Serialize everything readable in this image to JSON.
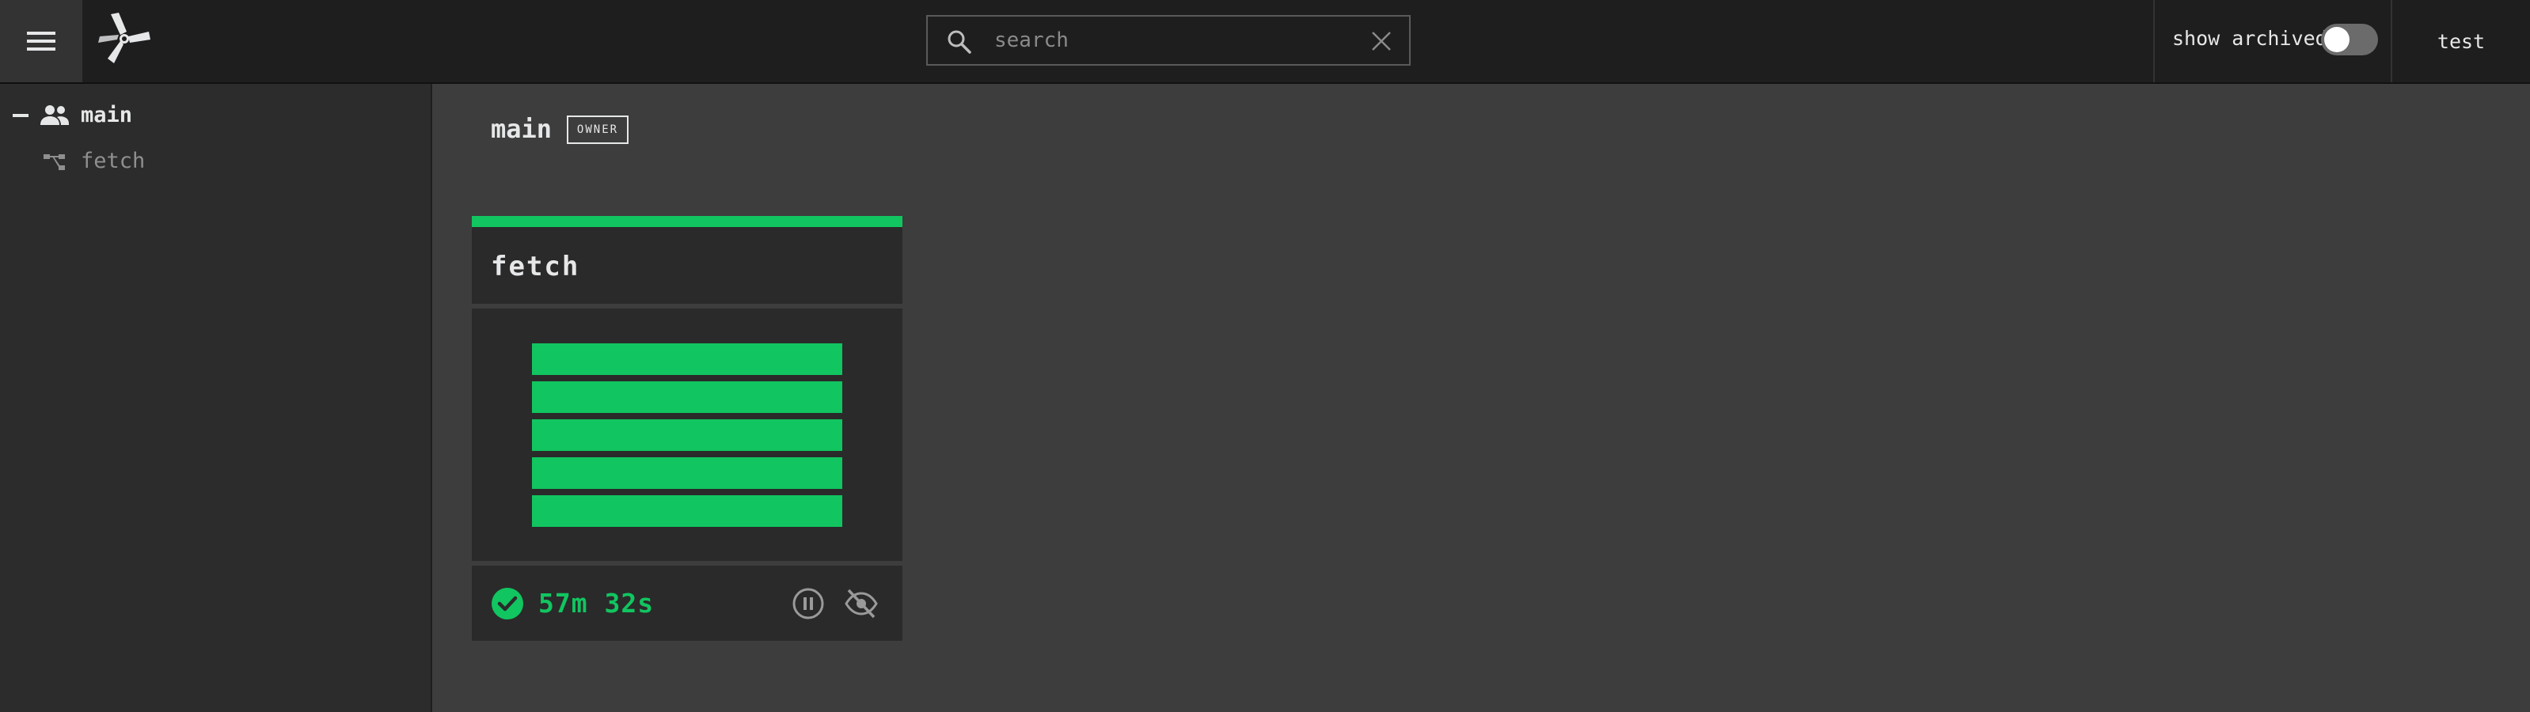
{
  "topbar": {
    "menu_icon": "hamburger-menu-icon",
    "logo_icon": "concourse-logo-icon",
    "search": {
      "placeholder": "search",
      "value": ""
    },
    "show_archived_label": "show archived",
    "show_archived_on": false,
    "user_label": "test"
  },
  "sidebar": {
    "team": {
      "label": "main",
      "icon": "team-people-icon",
      "expanded": true
    },
    "pipelines": [
      {
        "label": "fetch",
        "icon": "pipeline-icon"
      }
    ]
  },
  "main": {
    "team_title": "main",
    "role_badge": "OWNER",
    "pipeline_card": {
      "name": "fetch",
      "status": "succeeded",
      "status_color": "#11c560",
      "job_count": 5,
      "duration": "57m 32s",
      "status_icon": "check-circle-icon",
      "pause_icon": "pause-circle-icon",
      "visibility_icon": "eye-off-icon"
    }
  },
  "colors": {
    "background": "#3d3d3d",
    "topbar": "#1e1e1e",
    "sidebar": "#2c2c2c",
    "card": "#2a2a2a",
    "success": "#11c560"
  }
}
